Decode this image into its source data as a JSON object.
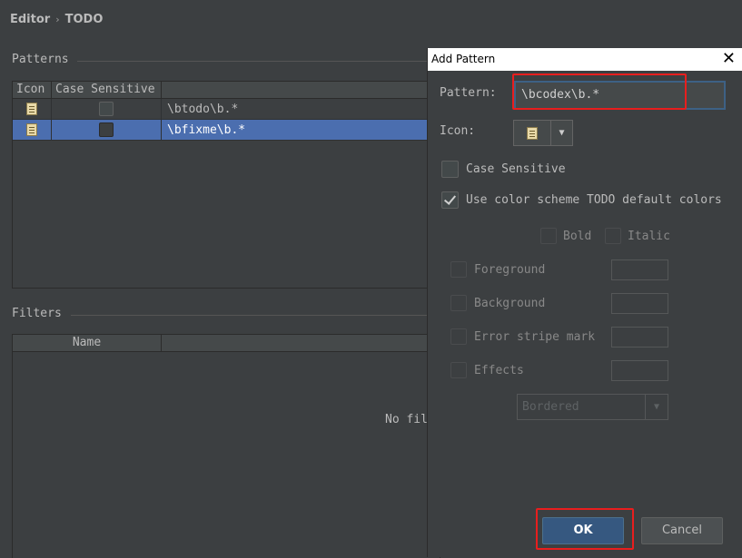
{
  "breadcrumb": {
    "parent": "Editor",
    "separator": "›",
    "current": "TODO"
  },
  "patterns": {
    "title": "Patterns",
    "columns": [
      "Icon",
      "Case Sensitive",
      ""
    ],
    "rows": [
      {
        "icon": "document-icon",
        "case_sensitive": false,
        "pattern": "\\btodo\\b.*",
        "selected": false
      },
      {
        "icon": "document-icon",
        "case_sensitive": false,
        "pattern": "\\bfixme\\b.*",
        "selected": true
      }
    ]
  },
  "filters": {
    "title": "Filters",
    "columns": [
      "Name"
    ],
    "empty_text": "No fil"
  },
  "dialog": {
    "title": "Add Pattern",
    "close_icon": "close-icon",
    "pattern_label": "Pattern:",
    "pattern_value": "\\bcodex\\b.*",
    "icon_label": "Icon:",
    "case_sensitive_label": "Case Sensitive",
    "case_sensitive": false,
    "use_default_colors_label": "Use color scheme TODO default colors",
    "use_default_colors": true,
    "bold_label": "Bold",
    "italic_label": "Italic",
    "foreground_label": "Foreground",
    "background_label": "Background",
    "error_stripe_label": "Error stripe mark",
    "effects_label": "Effects",
    "effect_type": "Bordered",
    "ok_label": "OK",
    "cancel_label": "Cancel"
  },
  "colors": {
    "background": "#3c3f41",
    "selection": "#4b6eaf",
    "default_button": "#365880",
    "highlight": "#e81e1e"
  }
}
